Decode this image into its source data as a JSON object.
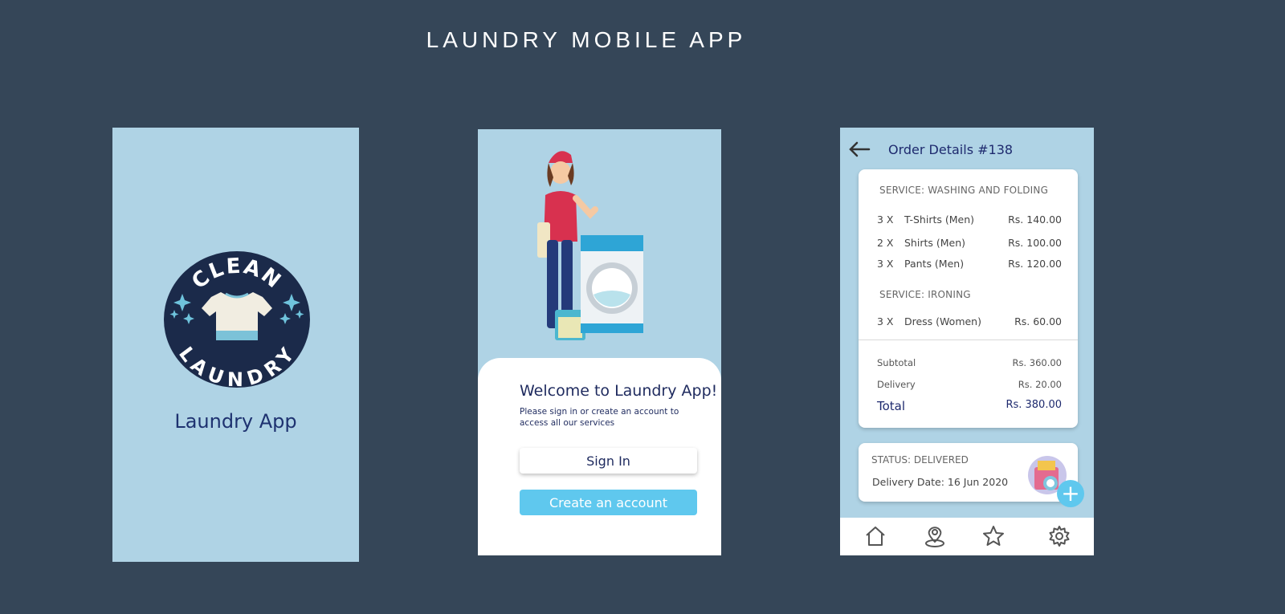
{
  "page": {
    "title": "LAUNDRY MOBILE APP"
  },
  "splash": {
    "logo_text_top": "CLEAN",
    "logo_text_bottom": "LAUNDRY",
    "app_name": "Laundry App"
  },
  "welcome": {
    "heading": "Welcome to Laundry App!",
    "subtitle": "Please sign in or create an account to access all our services",
    "sign_in_label": "Sign In",
    "create_account_label": "Create an account"
  },
  "order": {
    "title": "Order Details #138",
    "services": [
      {
        "name": "SERVICE: WASHING AND FOLDING",
        "items": [
          {
            "qty": "3 X",
            "name": "T-Shirts (Men)",
            "price": "Rs. 140.00"
          },
          {
            "qty": "2 X",
            "name": "Shirts (Men)",
            "price": "Rs. 100.00"
          },
          {
            "qty": "3 X",
            "name": "Pants (Men)",
            "price": "Rs. 120.00"
          }
        ]
      },
      {
        "name": "SERVICE: IRONING",
        "items": [
          {
            "qty": "3 X",
            "name": "Dress (Women)",
            "price": "Rs. 60.00"
          }
        ]
      }
    ],
    "subtotal_label": "Subtotal",
    "subtotal_value": "Rs. 360.00",
    "delivery_label": "Delivery",
    "delivery_value": "Rs. 20.00",
    "total_label": "Total",
    "total_value": "Rs. 380.00",
    "status": "STATUS: DELIVERED",
    "delivery_date": "Delivery Date: 16 Jun 2020",
    "fab_symbol": "+"
  },
  "nav": {
    "icons": [
      "home-icon",
      "location-pin-icon",
      "star-icon",
      "gear-icon"
    ]
  },
  "colors": {
    "page_background": "#354658",
    "screen_background": "#afd3e5",
    "navy_text": "#1e2a5e",
    "accent": "#5fc8ee",
    "logo_circle": "#1b2a4a"
  }
}
